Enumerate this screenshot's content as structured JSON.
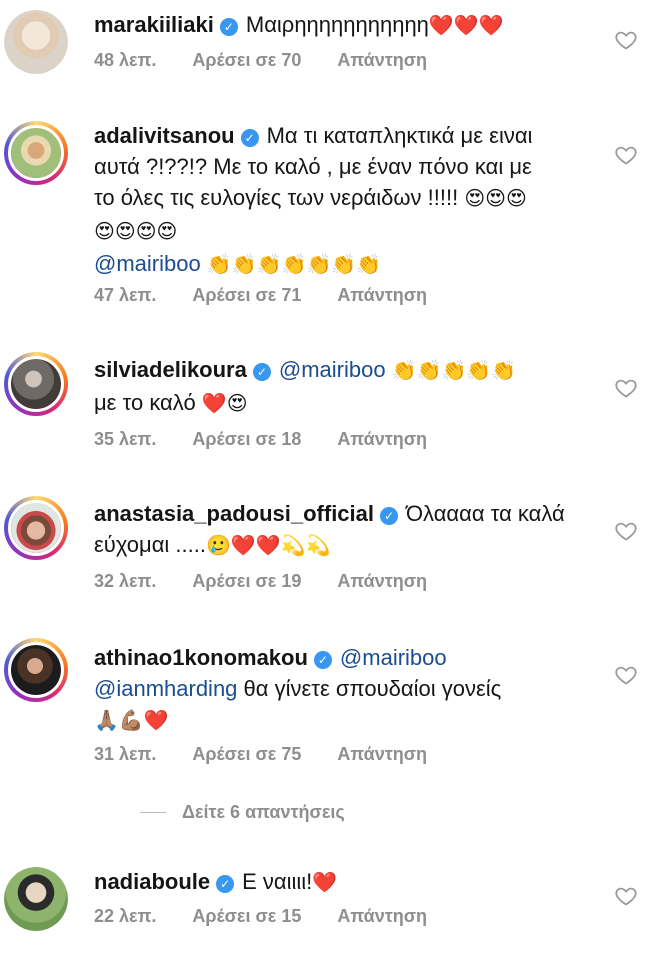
{
  "comments": [
    {
      "username": "marakiiliaki",
      "text": "Μαιρηηηηηηηηηηη",
      "emoji": "❤️❤️❤️",
      "time": "48 λεπ.",
      "likes": "Αρέσει σε 70",
      "reply": "Απάντηση",
      "avatar_color": "#e8ded2"
    },
    {
      "username": "adalivitsanou",
      "text": "Μα τι καταπληκτικά με ειναι αυτά ?!??!? Με το καλό , με έναν πόνο και με το όλες τις ευλογίες των νεράιδων !!!!!",
      "emoji": "😍😍😍😍😍😍😍",
      "mention": "@mairiboo",
      "emoji2": "👏👏👏👏👏👏👏",
      "time": "47 λεπ.",
      "likes": "Αρέσει σε 71",
      "reply": "Απάντηση",
      "avatar_color": "#c9b88a"
    },
    {
      "username": "silviadelikoura",
      "mention": "@mairiboo",
      "emoji": "👏👏👏👏👏",
      "text": "με το καλό",
      "emoji2": "❤️😍",
      "time": "35 λεπ.",
      "likes": "Αρέσει σε 18",
      "reply": "Απάντηση",
      "avatar_color": "#6f6a66"
    },
    {
      "username": "anastasia_padousi_official",
      "text": "Όλαααα τα καλά εύχομαι .....",
      "emoji": "🥲❤️❤️💫💫",
      "time": "32 λεπ.",
      "likes": "Αρέσει σε 19",
      "reply": "Απάντηση",
      "avatar_color": "#b07a6a"
    },
    {
      "username": "athinao1konomakou",
      "mention": "@mairiboo",
      "mention2": "@ianmharding",
      "text": "θα γίνετε σπουδαίοι γονείς",
      "emoji": "🙏🏽💪🏽❤️",
      "time": "31 λεπ.",
      "likes": "Αρέσει σε 75",
      "reply": "Απάντηση",
      "avatar_color": "#5a4a3e"
    },
    {
      "username": "nadiaboule",
      "text": "Ε ναιιιι!",
      "emoji": "❤️",
      "time": "22 λεπ.",
      "likes": "Αρέσει σε 15",
      "reply": "Απάντηση",
      "avatar_color": "#7fa36a"
    }
  ],
  "view_replies": "Δείτε 6 απαντήσεις",
  "colors": {
    "verified": "#3897f0",
    "mention": "#1b4d8f",
    "meta": "#8e8e8e"
  },
  "icons": {
    "like": "heart-outline-icon",
    "verified": "verified-badge-icon"
  }
}
